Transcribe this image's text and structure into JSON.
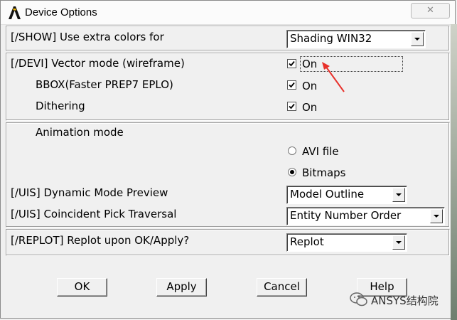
{
  "window": {
    "title": "Device Options",
    "close_glyph": "✕"
  },
  "show_section": {
    "label": "[/SHOW]  Use extra colors for",
    "value": "Shading    WIN32"
  },
  "devi_section": {
    "vector_label": "[/DEVI]  Vector mode (wireframe)",
    "vector_value": "On",
    "bbox_label": "BBOX(Faster PREP7 EPLO)",
    "bbox_value": "On",
    "dither_label": "Dithering",
    "dither_value": "On"
  },
  "anim_section": {
    "anim_label": "Animation mode",
    "opt_avi": "AVI file",
    "opt_bitmaps": "Bitmaps",
    "dyn_label": "[/UIS] Dynamic Mode Preview",
    "dyn_value": "Model Outline",
    "pick_label": "[/UIS] Coincident Pick Traversal",
    "pick_value": "Entity Number Order"
  },
  "replot_section": {
    "label": "[/REPLOT] Replot upon OK/Apply?",
    "value": "Replot"
  },
  "buttons": {
    "ok": "OK",
    "apply": "Apply",
    "cancel": "Cancel",
    "help": "Help"
  },
  "watermark": {
    "text": "ANSYS结构院"
  },
  "colors": {
    "annotation_arrow": "#e8302a"
  }
}
